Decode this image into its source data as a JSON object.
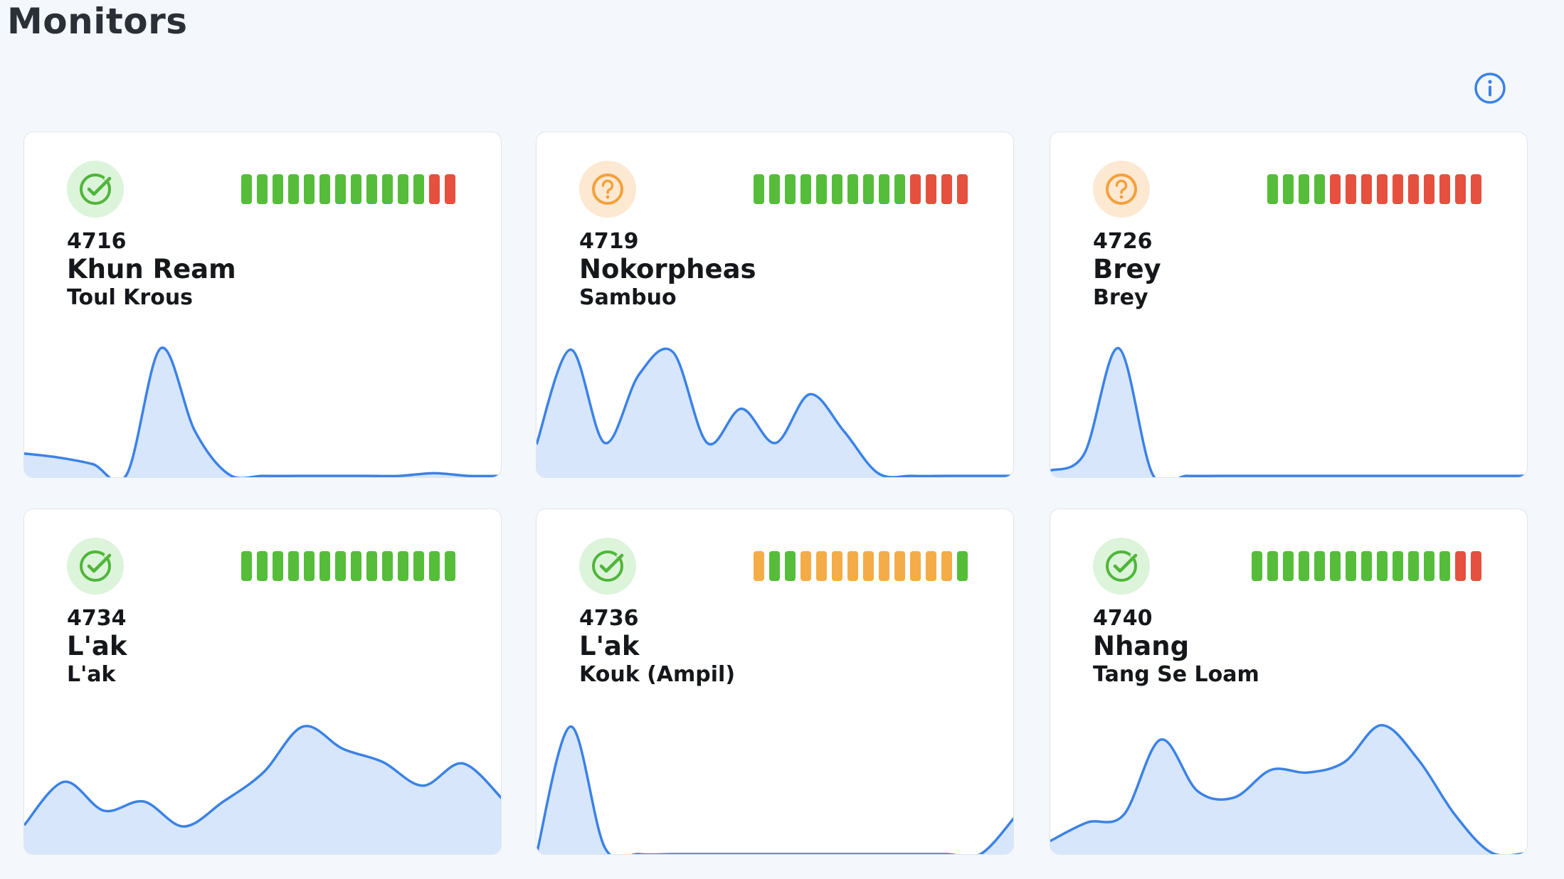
{
  "page": {
    "title": "Monitors"
  },
  "colors": {
    "green": "#55bd3a",
    "red": "#e5503f",
    "orange": "#f4ac48",
    "line": "#3b82e6",
    "fill": "#d7e6fb",
    "info": "#3b82e6"
  },
  "monitors": [
    {
      "id": "4716",
      "name": "Khun Ream",
      "location": "Toul Krous",
      "status": "ok",
      "status_icon": "check-circle-icon",
      "history": [
        "green",
        "green",
        "green",
        "green",
        "green",
        "green",
        "green",
        "green",
        "green",
        "green",
        "green",
        "green",
        "red",
        "red"
      ],
      "trend": [
        0.18,
        0.15,
        0.1,
        0.02,
        0.98,
        0.35,
        0.02,
        0.01,
        0.01,
        0.01,
        0.01,
        0.01,
        0.03,
        0.01,
        0.01
      ]
    },
    {
      "id": "4719",
      "name": "Nokorpheas",
      "location": "Sambuo",
      "status": "unknown",
      "status_icon": "question-circle-icon",
      "history": [
        "green",
        "green",
        "green",
        "green",
        "green",
        "green",
        "green",
        "green",
        "green",
        "green",
        "red",
        "red",
        "red",
        "red"
      ],
      "trend": [
        0.25,
        0.97,
        0.26,
        0.78,
        0.95,
        0.26,
        0.52,
        0.26,
        0.63,
        0.35,
        0.03,
        0.01,
        0.01,
        0.01,
        0.01
      ]
    },
    {
      "id": "4726",
      "name": "Brey",
      "location": "Brey",
      "status": "unknown",
      "status_icon": "question-circle-icon",
      "history": [
        "green",
        "green",
        "green",
        "green",
        "red",
        "red",
        "red",
        "red",
        "red",
        "red",
        "red",
        "red",
        "red",
        "red"
      ],
      "trend": [
        0.05,
        0.18,
        0.98,
        0.02,
        0.01,
        0.01,
        0.01,
        0.01,
        0.01,
        0.01,
        0.01,
        0.01,
        0.01,
        0.01,
        0.01
      ]
    },
    {
      "id": "4734",
      "name": "L'ak",
      "location": "L'ak",
      "status": "ok",
      "status_icon": "check-circle-icon",
      "history": [
        "green",
        "green",
        "green",
        "green",
        "green",
        "green",
        "green",
        "green",
        "green",
        "green",
        "green",
        "green",
        "green",
        "green"
      ],
      "trend": [
        0.22,
        0.55,
        0.33,
        0.4,
        0.21,
        0.4,
        0.62,
        0.97,
        0.8,
        0.7,
        0.52,
        0.69,
        0.42
      ]
    },
    {
      "id": "4736",
      "name": "L'ak",
      "location": "Kouk (Ampil)",
      "status": "ok",
      "status_icon": "check-circle-icon",
      "history": [
        "orange",
        "green",
        "green",
        "orange",
        "orange",
        "orange",
        "orange",
        "orange",
        "orange",
        "orange",
        "orange",
        "orange",
        "orange",
        "green"
      ],
      "trend": [
        0.0,
        0.97,
        0.05,
        0.0,
        0.0,
        0.0,
        0.0,
        0.0,
        0.0,
        0.0,
        0.0,
        0.0,
        0.0,
        0.0,
        0.28
      ]
    },
    {
      "id": "4740",
      "name": "Nhang",
      "location": "Tang Se Loam",
      "status": "ok",
      "status_icon": "check-circle-icon",
      "history": [
        "green",
        "green",
        "green",
        "green",
        "green",
        "green",
        "green",
        "green",
        "green",
        "green",
        "green",
        "green",
        "green",
        "red",
        "red"
      ],
      "trend": [
        0.1,
        0.24,
        0.3,
        0.87,
        0.48,
        0.43,
        0.64,
        0.62,
        0.7,
        0.98,
        0.72,
        0.3,
        0.01,
        0.01
      ]
    }
  ]
}
